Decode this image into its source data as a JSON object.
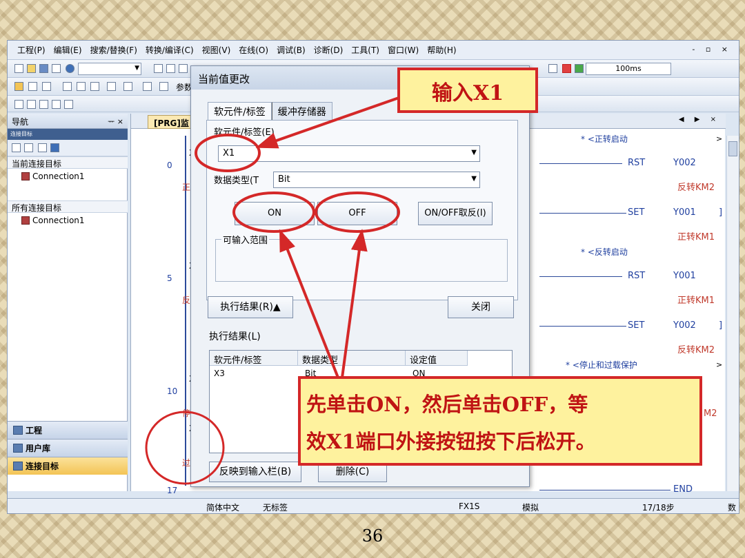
{
  "menu": [
    "工程(P)",
    "编辑(E)",
    "搜索/替换(F)",
    "转换/编译(C)",
    "视图(V)",
    "在线(O)",
    "调试(B)",
    "诊断(D)",
    "工具(T)",
    "窗口(W)",
    "帮助(H)"
  ],
  "window_controls": "- ▫ ×",
  "toolbar": {
    "speed": "100ms",
    "params_label": "参数"
  },
  "navigation": {
    "title": "导航",
    "subheader": "连接目标",
    "current_section": "当前连接目标",
    "current_item": "Connection1",
    "all_section": "所有连接目标",
    "all_item": "Connection1",
    "buttons": [
      "工程",
      "用户库",
      "连接目标"
    ]
  },
  "editor": {
    "tab": "[PRG]监",
    "steps": [
      "0",
      "5",
      "10",
      "17"
    ],
    "contact_x": [
      "X",
      "X",
      "X",
      "X"
    ],
    "red_labels": [
      "正",
      "反",
      "停",
      "过载"
    ],
    "comments": {
      "c1": "* <正转启动",
      "c2": "* <反转启动",
      "c3": "* <停止和过载保护"
    },
    "rungs": [
      {
        "cmd": "RST",
        "dev": "Y002",
        "cmt": "反转KM2"
      },
      {
        "cmd": "SET",
        "dev": "Y001",
        "cmt": "正转KM1"
      },
      {
        "cmd": "RST",
        "dev": "Y001",
        "cmt": "正转KM1"
      },
      {
        "cmd": "SET",
        "dev": "Y002",
        "cmt": "反转KM2"
      }
    ],
    "rung5_tail": "M2",
    "end_label": "END"
  },
  "statusbar": {
    "lang": "简体中文",
    "label": "无标签",
    "plc": "FX1S",
    "mode": "模拟",
    "step": "17/18步",
    "caps": "数"
  },
  "dialog": {
    "title": "当前值更改",
    "tabs": [
      "软元件/标签",
      "缓冲存储器"
    ],
    "device_label": "软元件/标签(E)",
    "device_value": "X1",
    "type_label": "数据类型(T",
    "type_value": "Bit",
    "on_button": "ON",
    "off_button": "OFF",
    "toggle_button": "ON/OFF取反(I)",
    "range_label": "可输入范围",
    "result_toggle": "执行结果(R)▲",
    "close_button": "关闭",
    "result_label": "执行结果(L)",
    "grid_headers": [
      "软元件/标签",
      "数据类型",
      "设定值"
    ],
    "grid_row": [
      "X3",
      "Bit",
      "ON"
    ],
    "reflect_button": "反映到输入栏(B)",
    "delete_button": "删除(C)"
  },
  "annotations": {
    "callout_top": "输入X1",
    "callout_bottom_line1": "先单击ON，然后单击OFF，等",
    "callout_bottom_line2": "效X1端口外接按钮按下后松开。",
    "highlight_color": "#d42828"
  },
  "page_number": "36"
}
